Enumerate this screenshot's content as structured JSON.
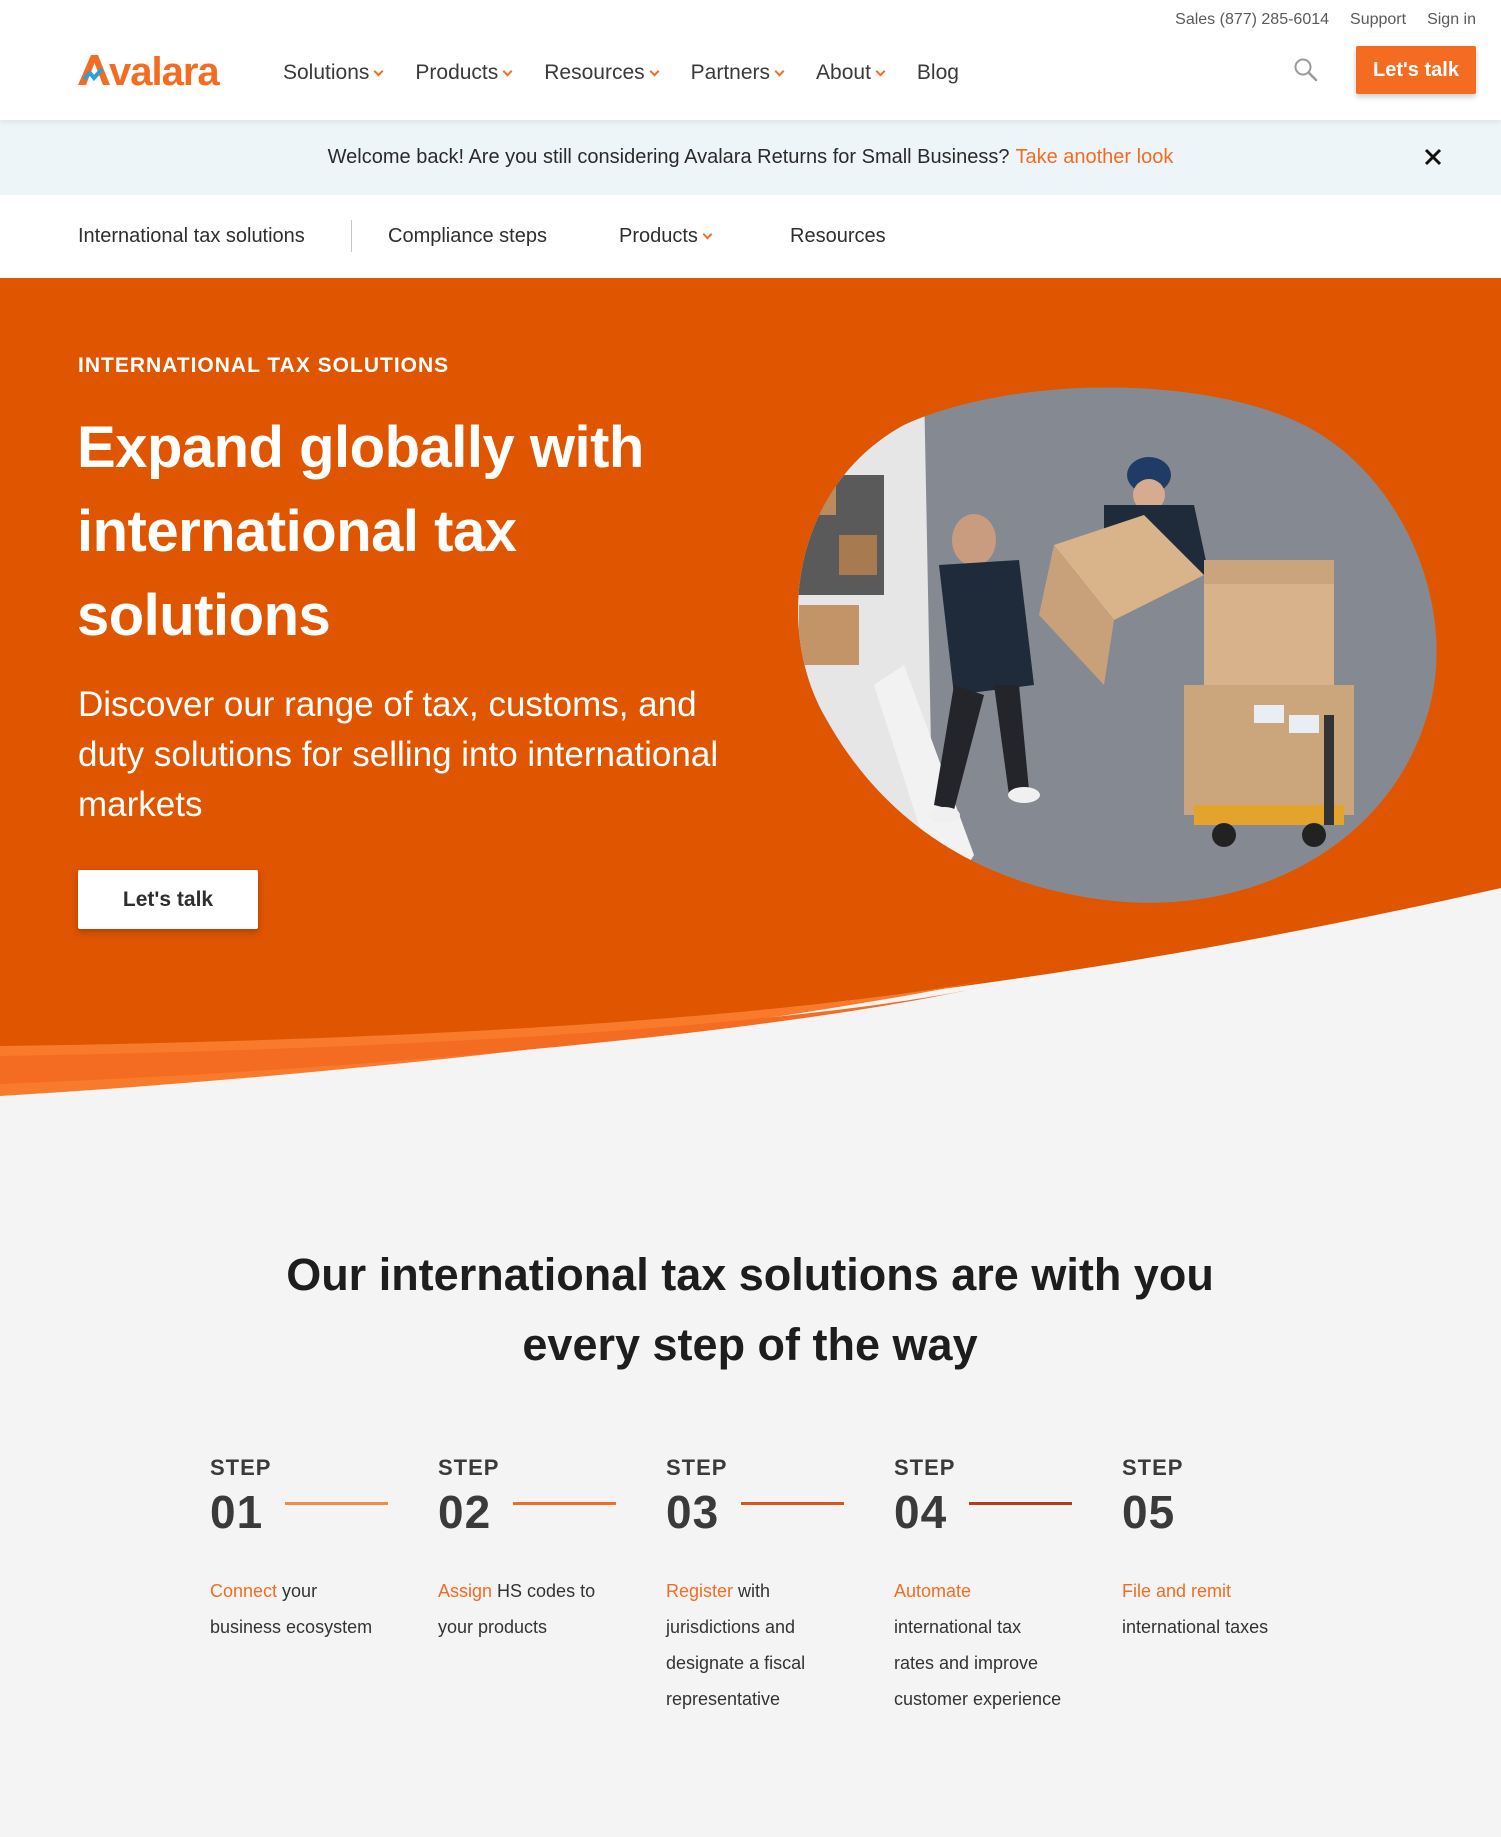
{
  "utility": {
    "sales": "Sales (877) 285-6014",
    "support": "Support",
    "sign_in": "Sign in"
  },
  "brand": {
    "logo_text": "Avalara",
    "accent": "#f36c21"
  },
  "nav": {
    "items": [
      "Solutions",
      "Products",
      "Resources",
      "Partners",
      "About",
      "Blog"
    ]
  },
  "header": {
    "cta_label": "Let's talk"
  },
  "banner": {
    "text": "Welcome back! Are you still considering Avalara Returns for Small Business?",
    "link": "Take another look"
  },
  "subnav": {
    "items": [
      "International tax solutions",
      "Compliance steps",
      "Products",
      "Resources"
    ]
  },
  "hero": {
    "eyebrow": "INTERNATIONAL TAX SOLUTIONS",
    "title": "Expand globally with international tax solutions",
    "subtitle": "Discover our range of tax, customs, and duty solutions for selling into international markets",
    "button": "Let's talk",
    "bg_color": "#e05500"
  },
  "steps_section": {
    "title": "Our international tax solutions are with you every step of the way",
    "step_label": "STEP",
    "steps": [
      {
        "num": "01",
        "highlight": "Connect",
        "rest": " your business ecosystem",
        "bar_color": "#f58a45"
      },
      {
        "num": "02",
        "highlight": "Assign",
        "rest": " HS codes to your products",
        "bar_color": "#ee6f25"
      },
      {
        "num": "03",
        "highlight": "Register",
        "rest": " with jurisdictions and designate a fiscal representative",
        "bar_color": "#d9561a"
      },
      {
        "num": "04",
        "highlight": "Automate",
        "rest": " international tax rates and improve customer experience",
        "bar_color": "#b83d16"
      },
      {
        "num": "05",
        "highlight": "File and remit",
        "rest": " international taxes",
        "bar_color": "#9e3412"
      }
    ]
  }
}
